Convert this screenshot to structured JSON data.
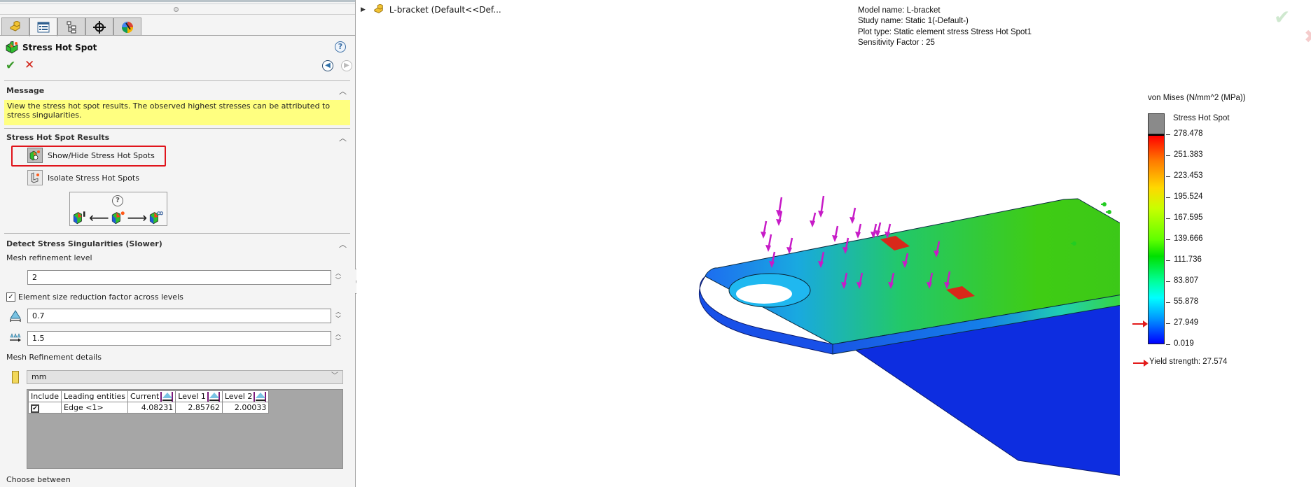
{
  "property_manager": {
    "tabs": [
      {
        "name": "feature-manager",
        "icon": "part-icon"
      },
      {
        "name": "property-manager",
        "icon": "property-list-icon",
        "active": true
      },
      {
        "name": "configuration-manager",
        "icon": "configuration-tree-icon"
      },
      {
        "name": "dimxpert-manager",
        "icon": "crosshair-icon"
      },
      {
        "name": "display-manager",
        "icon": "appearance-ball-icon"
      }
    ],
    "title": "Stress Hot Spot",
    "help_label": "?",
    "ok_symbol": "✔",
    "cancel_symbol": "✕",
    "message": {
      "heading": "Message",
      "text": "View the stress hot spot results. The observed highest stresses can be attributed to stress singularities."
    },
    "results": {
      "heading": "Stress Hot Spot Results",
      "show_hide_label": "Show/Hide Stress Hot Spots",
      "isolate_label": "Isolate Stress Hot Spots",
      "diagram_help": "?",
      "arrow_left": "⟵",
      "arrow_right": "⟶"
    },
    "detect": {
      "heading": "Detect Stress Singularities (Slower)",
      "mesh_level_label": "Mesh refinement level",
      "mesh_level_value": "2",
      "reduction_checkbox_label": "Element size reduction factor across levels",
      "reduction_checked": true,
      "element_size_factor": "0.7",
      "growth_ratio": "1.5",
      "details_label": "Mesh Refinement details",
      "unit": "mm",
      "table": {
        "headers": [
          "Include",
          "Leading entities",
          "Current",
          "Level 1",
          "Level 2"
        ],
        "rows": [
          {
            "include": "✔",
            "entity": "Edge <1>",
            "current": "4.08231",
            "level1": "2.85762",
            "level2": "2.00033"
          }
        ]
      },
      "choose_label": "Choose between"
    }
  },
  "viewport": {
    "tree_node": "L-bracket  (Default<<Def...",
    "info": {
      "model": "Model name: L-bracket",
      "study": "Study name: Static 1(-Default-)",
      "plot": "Plot type: Static element stress Stress Hot Spot1",
      "sensitivity": "Sensitivity Factor : 25"
    },
    "legend": {
      "title": "von Mises (N/mm^2 (MPa))",
      "hot_spot_label": "Stress Hot Spot",
      "hot_spot_color": "#8a8a8a",
      "ticks": [
        "278.478",
        "251.383",
        "223.453",
        "195.524",
        "167.595",
        "139.666",
        "111.736",
        "83.807",
        "55.878",
        "27.949",
        "0.019"
      ],
      "max": 278.478,
      "min": 0.019,
      "yield_label": "Yield strength: 27.574",
      "yield_value": 27.574
    },
    "colors": {
      "load_arrows": "#c71bc7",
      "fixtures": "#22cc22",
      "hot_spot_patch": "#d8281a"
    }
  }
}
